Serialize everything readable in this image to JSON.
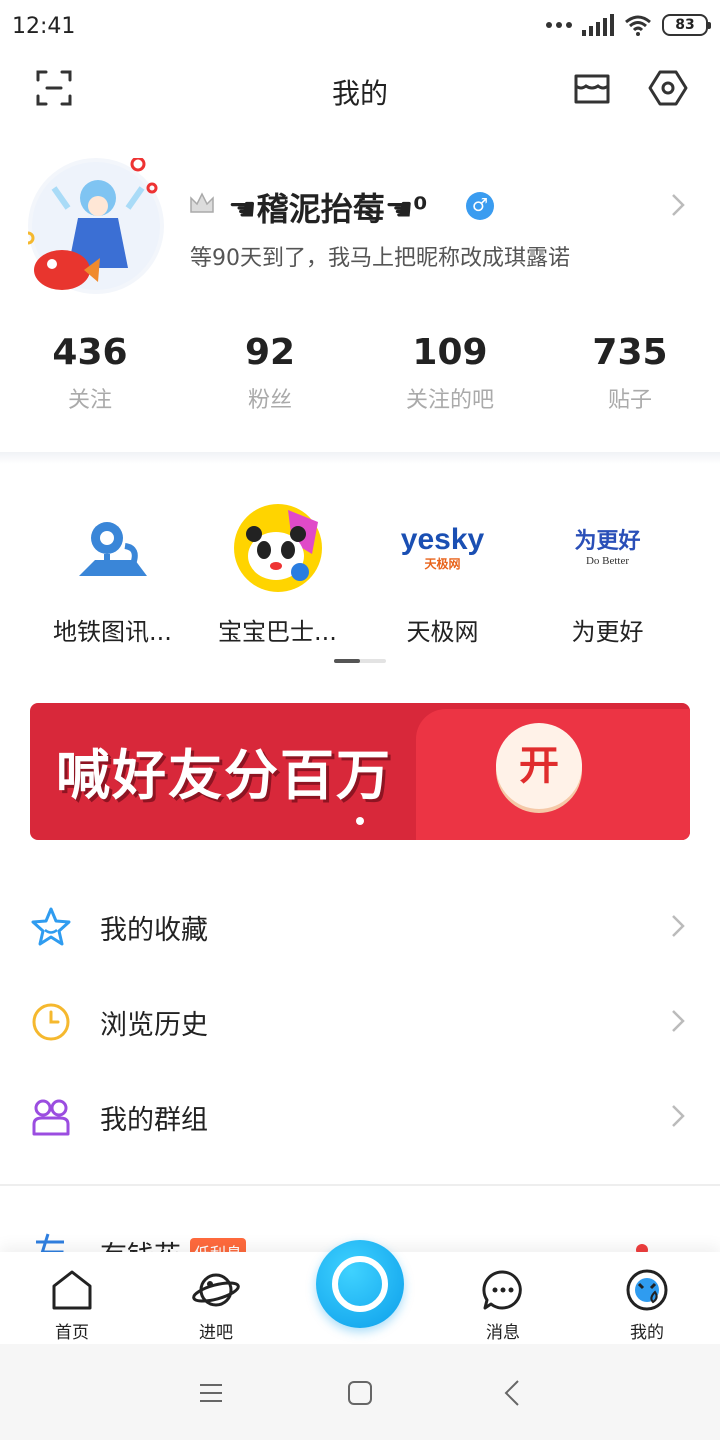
{
  "status": {
    "time": "12:41",
    "battery": "83"
  },
  "header": {
    "title": "我的",
    "icons": [
      "scan-icon",
      "store-icon",
      "settings-icon"
    ]
  },
  "profile": {
    "username": "☚稽泥抬莓☚⁰",
    "bio": "等90天到了，我马上把昵称改成琪露诺",
    "gender": "♂",
    "stats": [
      {
        "value": "436",
        "label": "关注"
      },
      {
        "value": "92",
        "label": "粉丝"
      },
      {
        "value": "109",
        "label": "关注的吧"
      },
      {
        "value": "735",
        "label": "贴子"
      }
    ]
  },
  "apps": [
    {
      "label": "地铁图讯...",
      "icon": "metro-map-icon"
    },
    {
      "label": "宝宝巴士...",
      "icon": "baby-bus-icon"
    },
    {
      "label": "天极网",
      "icon": "yesky-logo",
      "logo_main": "yesky",
      "logo_sub": "天极网"
    },
    {
      "label": "为更好",
      "icon": "weigenghao-logo",
      "logo_main": "为更好",
      "logo_sub": "Do Better"
    }
  ],
  "banner": {
    "text": "喊好友分百万",
    "button": "开"
  },
  "menu": [
    {
      "label": "我的收藏",
      "icon": "star-icon",
      "color": "#2f9cf0"
    },
    {
      "label": "浏览历史",
      "icon": "clock-icon",
      "color": "#f5b82e"
    },
    {
      "label": "我的群组",
      "icon": "group-icon",
      "color": "#9b4de0"
    }
  ],
  "partial_menu": {
    "label": "有钱花",
    "badge": "低利息"
  },
  "tabs": [
    {
      "label": "首页",
      "icon": "home-icon"
    },
    {
      "label": "进吧",
      "icon": "planet-icon"
    },
    {
      "label": "",
      "icon": "camera-button-icon"
    },
    {
      "label": "消息",
      "icon": "message-icon"
    },
    {
      "label": "我的",
      "icon": "profile-icon"
    }
  ],
  "colors": {
    "accent": "#0c9eea",
    "banner_red": "#d8283a"
  }
}
